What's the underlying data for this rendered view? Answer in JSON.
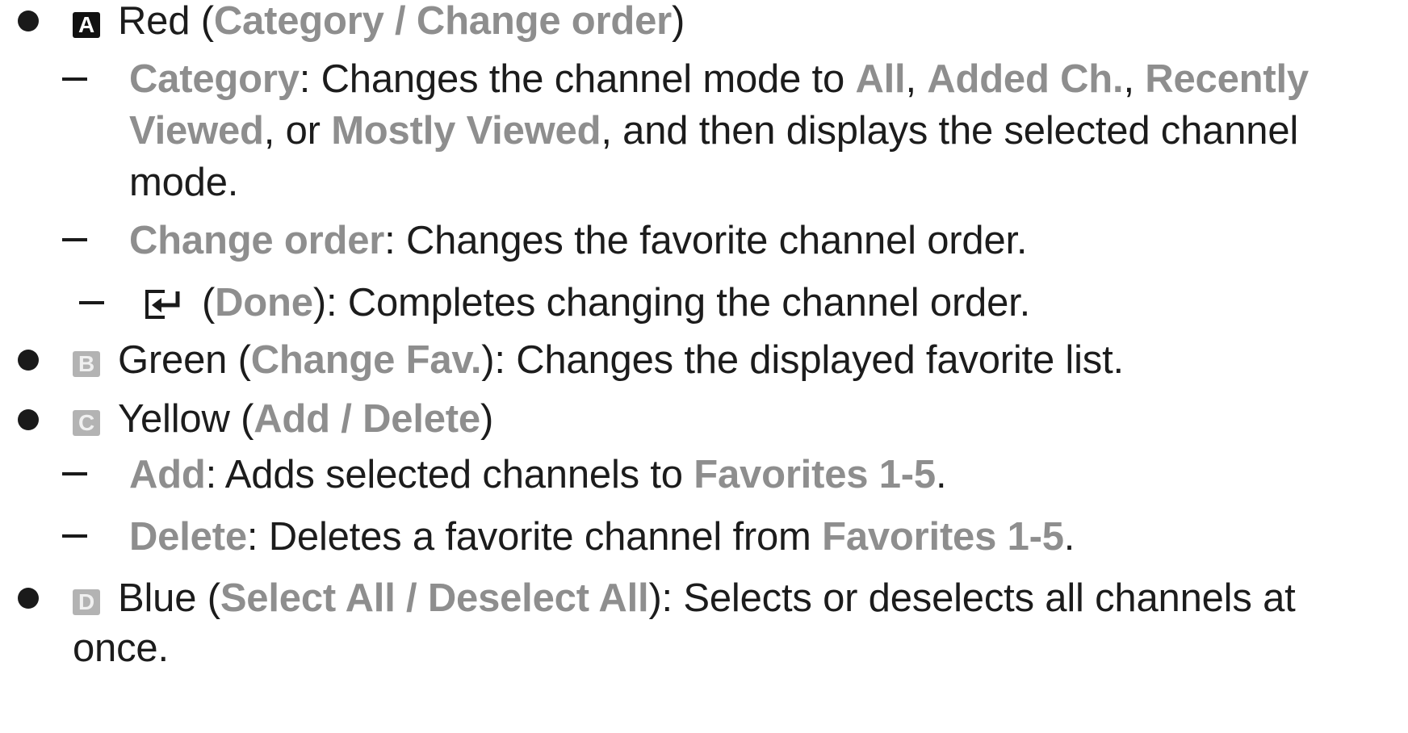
{
  "items": {
    "red": {
      "key_letter": "A",
      "label": "Red",
      "open_paren": "(",
      "kw1": "Category",
      "slash": " / ",
      "kw2": "Change order",
      "close_paren": ")",
      "sub_category": {
        "kw": "Category",
        "text1": ": Changes the channel mode to ",
        "kw_all": "All",
        "comma1": ", ",
        "kw_added": "Added Ch.",
        "comma2": ", ",
        "kw_recently": "Recently",
        "kw_viewed": "Viewed",
        "text_or": ", or ",
        "kw_mostly": "Mostly Viewed",
        "text2": ", and then displays the selected channel",
        "text3": "mode."
      },
      "sub_change_order": {
        "kw": "Change order",
        "text": ": Changes the favorite channel order."
      },
      "sub_done": {
        "open_paren": "(",
        "kw": "Done",
        "text": "): Completes changing the channel order."
      }
    },
    "green": {
      "key_letter": "B",
      "label": "Green",
      "open_paren": "(",
      "kw": "Change Fav.",
      "text": "): Changes the displayed favorite list."
    },
    "yellow": {
      "key_letter": "C",
      "label": "Yellow",
      "open_paren": "(",
      "kw": "Add / Delete",
      "close_paren": ")",
      "sub_add": {
        "kw": "Add",
        "text": ": Adds selected channels to ",
        "kw_fav": "Favorites 1-5",
        "period": "."
      },
      "sub_delete": {
        "kw": "Delete",
        "text": ": Deletes a favorite channel from ",
        "kw_fav": "Favorites 1-5",
        "period": "."
      }
    },
    "blue": {
      "key_letter": "D",
      "label": "Blue",
      "open_paren": "(",
      "kw": "Select All / Deselect All",
      "text": "): Selects or deselects all channels at",
      "text2": "once."
    }
  },
  "icons": {
    "red_key": "key-a-icon",
    "green_key": "key-b-icon",
    "yellow_key": "key-c-icon",
    "blue_key": "key-d-icon",
    "done": "enter-return-icon"
  },
  "colors": {
    "text": "#1c1c1c",
    "keyword": "#8e8e8e",
    "key_dark": "#111111",
    "key_light": "#b3b3b3"
  }
}
